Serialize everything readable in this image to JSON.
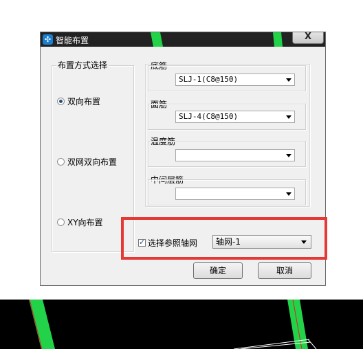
{
  "dialog": {
    "title": "智能布置",
    "close_label": "X",
    "icon": "app-logo-icon"
  },
  "layout_group": {
    "legend": "布置方式选择",
    "options": [
      {
        "label": "双向布置",
        "checked": true
      },
      {
        "label": "双网双向布置",
        "checked": false
      },
      {
        "label": "XY向布置",
        "checked": false
      }
    ]
  },
  "rebar": {
    "bottom": {
      "label": "底筋",
      "value": "SLJ-1(C8@150)"
    },
    "top": {
      "label": "面筋",
      "value": "SLJ-4(C8@150)"
    },
    "temperature": {
      "label": "温度筋",
      "value": ""
    },
    "middle": {
      "label": "中间层筋",
      "value": ""
    }
  },
  "axis_ref": {
    "checkbox_label": "选择参照轴网",
    "checked": true,
    "selected": "轴网-1"
  },
  "buttons": {
    "ok": "确定",
    "cancel": "取消"
  },
  "colors": {
    "highlight": "#e53935",
    "cad_green": "#22d34a",
    "cad_background": "#000000"
  }
}
